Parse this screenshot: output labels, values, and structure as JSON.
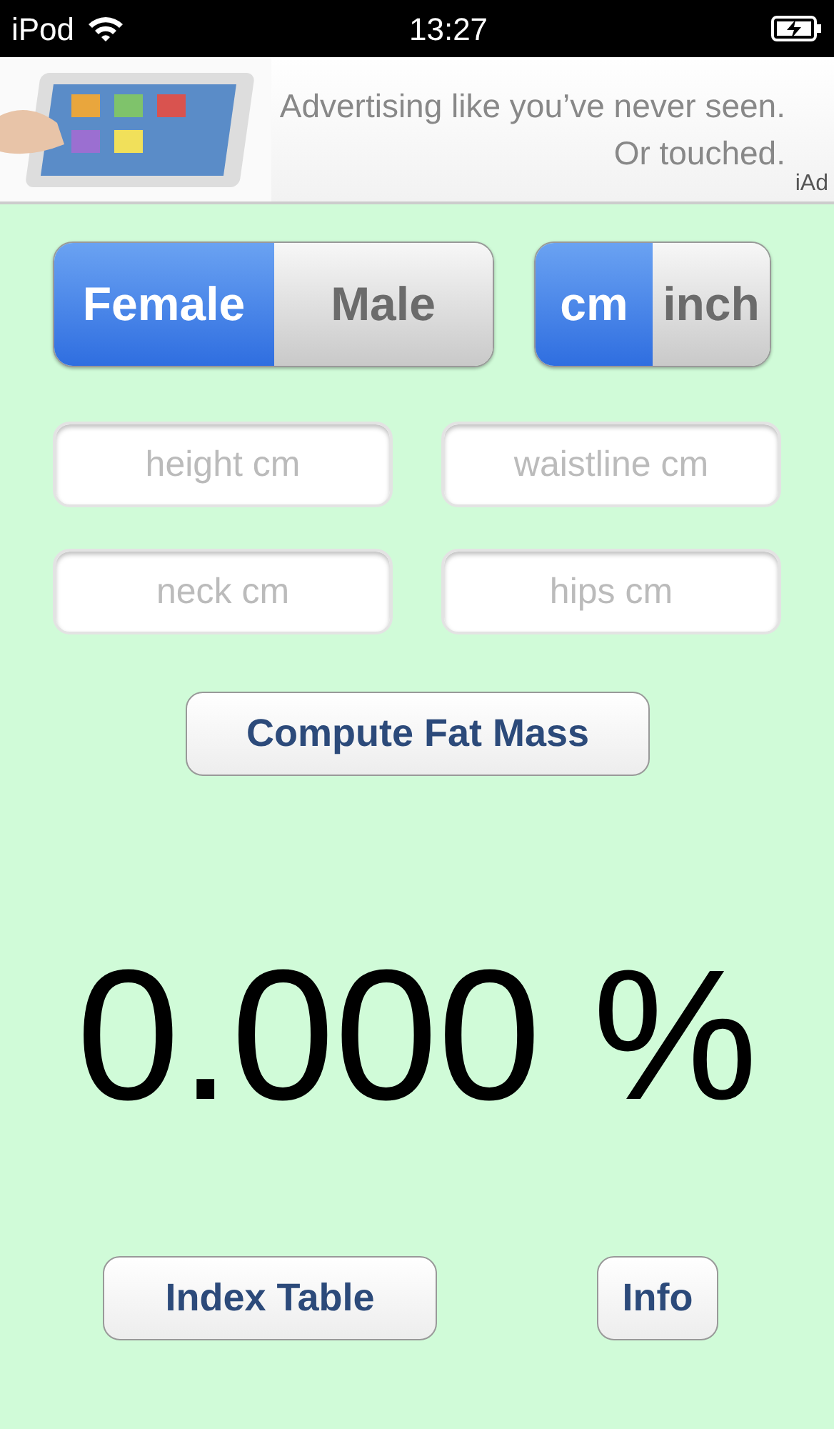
{
  "status_bar": {
    "carrier": "iPod",
    "time": "13:27"
  },
  "ad": {
    "lines": [
      "Advertising like you’ve never seen.",
      "Or touched."
    ],
    "badge": "iAd"
  },
  "gender": [
    {
      "label": "Female",
      "selected": true
    },
    {
      "label": "Male",
      "selected": false
    }
  ],
  "units": [
    {
      "label": "cm",
      "selected": true
    },
    {
      "label": "inch",
      "selected": false
    }
  ],
  "fields": [
    {
      "placeholder": "height cm"
    },
    {
      "placeholder": "waistline cm"
    },
    {
      "placeholder": "neck cm"
    },
    {
      "placeholder": "hips cm"
    }
  ],
  "compute_button": "Compute Fat Mass",
  "result": "0.000 %",
  "buttons": [
    {
      "label": "Index Table"
    },
    {
      "label": "Info"
    }
  ]
}
